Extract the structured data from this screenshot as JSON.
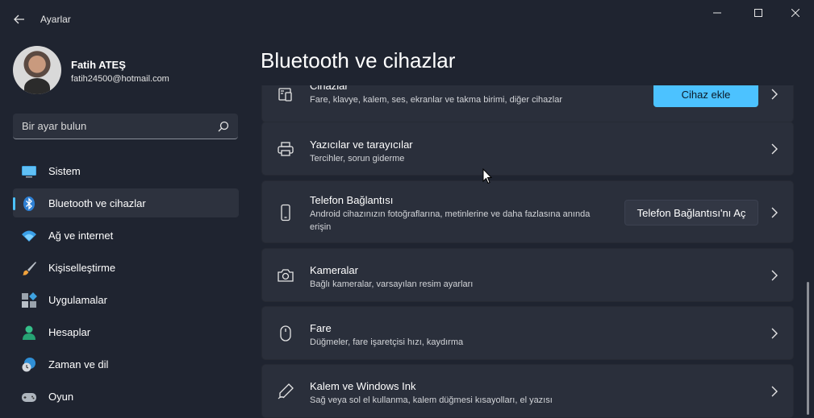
{
  "window": {
    "title": "Ayarlar",
    "controls": {
      "minimize": "—",
      "maximize": "☐",
      "close": "✕"
    }
  },
  "profile": {
    "name": "Fatih ATEŞ",
    "email": "fatih24500@hotmail.com"
  },
  "search": {
    "placeholder": "Bir ayar bulun"
  },
  "sidebar": {
    "items": [
      {
        "label": "Sistem",
        "icon": "monitor-icon"
      },
      {
        "label": "Bluetooth ve cihazlar",
        "icon": "bluetooth-icon",
        "active": true
      },
      {
        "label": "Ağ ve internet",
        "icon": "wifi-icon"
      },
      {
        "label": "Kişiselleştirme",
        "icon": "brush-icon"
      },
      {
        "label": "Uygulamalar",
        "icon": "apps-icon"
      },
      {
        "label": "Hesaplar",
        "icon": "person-icon"
      },
      {
        "label": "Zaman ve dil",
        "icon": "globe-clock-icon"
      },
      {
        "label": "Oyun",
        "icon": "gamepad-icon"
      }
    ]
  },
  "main": {
    "title": "Bluetooth ve cihazlar",
    "cards": [
      {
        "title": "Cihazlar",
        "desc": "Fare, klavye, kalem, ses, ekranlar ve takma birimi, diğer cihazlar",
        "button": "Cihaz ekle",
        "icon": "devices-icon"
      },
      {
        "title": "Yazıcılar ve tarayıcılar",
        "desc": "Tercihler, sorun giderme",
        "icon": "printer-icon"
      },
      {
        "title": "Telefon Bağlantısı",
        "desc": "Android cihazınızın fotoğraflarına, metinlerine ve daha fazlasına anında erişin",
        "button": "Telefon Bağlantısı'nı Aç",
        "icon": "phone-icon"
      },
      {
        "title": "Kameralar",
        "desc": "Bağlı kameralar, varsayılan resim ayarları",
        "icon": "camera-icon"
      },
      {
        "title": "Fare",
        "desc": "Düğmeler, fare işaretçisi hızı, kaydırma",
        "icon": "mouse-icon"
      },
      {
        "title": "Kalem ve Windows Ink",
        "desc": "Sağ veya sol el kullanma, kalem düğmesi kısayolları, el yazısı",
        "icon": "pen-icon"
      }
    ]
  },
  "colors": {
    "accent": "#4cc2ff",
    "background": "#1f2430",
    "card": "#2a2f3b"
  }
}
